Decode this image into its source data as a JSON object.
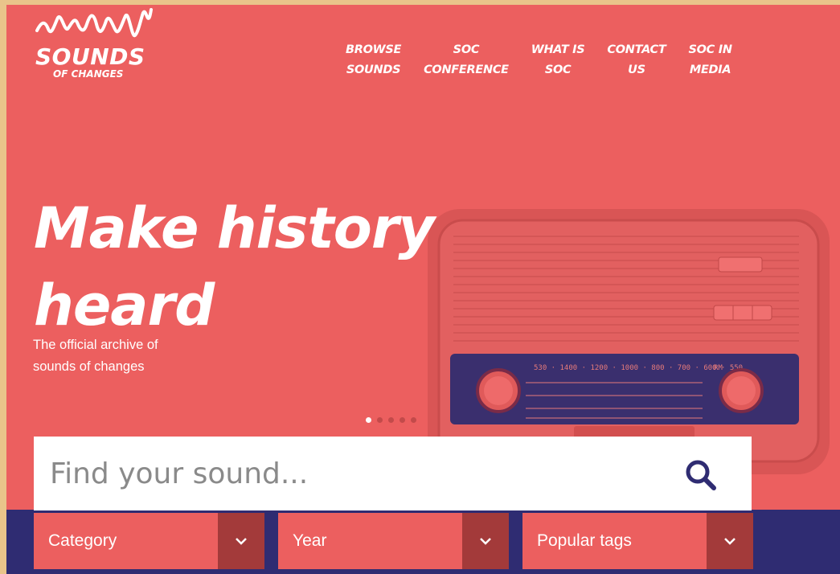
{
  "logo": {
    "title": "SOUNDS",
    "subtitle": "OF CHANGES"
  },
  "nav": [
    {
      "line1": "BROWSE",
      "line2": "SOUNDS"
    },
    {
      "line1": "SOC",
      "line2": "CONFERENCE"
    },
    {
      "line1": "WHAT IS",
      "line2": "SOC"
    },
    {
      "line1": "CONTACT",
      "line2": "US"
    },
    {
      "line1": "SOC IN",
      "line2": "MEDIA"
    }
  ],
  "hero": {
    "title_line1": "Make history",
    "title_line2": "heard",
    "subtitle_line1": "The official archive of",
    "subtitle_line2": "sounds of changes"
  },
  "radio": {
    "dial_numbers": "530 · 1400 · 1200 · 1000 · 800 · 700 · 600 · 550",
    "band": "RM"
  },
  "search": {
    "placeholder": "Find your sound..."
  },
  "filters": [
    {
      "label": "Category"
    },
    {
      "label": "Year"
    },
    {
      "label": "Popular tags"
    }
  ],
  "colors": {
    "primary": "#ec5f5f",
    "dark_band": "#2f2c72",
    "chevron_bg": "#a33a3a",
    "icon": "#2f2c72"
  }
}
